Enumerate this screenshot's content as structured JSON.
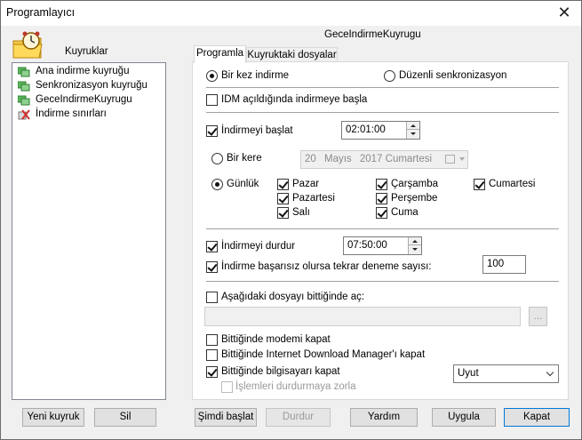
{
  "window": {
    "title": "Programlayıcı",
    "close_glyph": "✕"
  },
  "left": {
    "header": "Kuyruklar",
    "items": [
      {
        "label": "Ana indirme kuyruğu",
        "icon": "queue-icon"
      },
      {
        "label": "Senkronizasyon kuyruğu",
        "icon": "queue-icon"
      },
      {
        "label": "GeceIndirmeKuyrugu",
        "icon": "queue-icon"
      },
      {
        "label": "İndirme sınırları",
        "icon": "limits-icon"
      }
    ],
    "new_queue": "Yeni kuyruk",
    "delete": "Sil"
  },
  "right": {
    "queue_title": "GeceIndirmeKuyrugu",
    "tabs": [
      {
        "label": "Programla"
      },
      {
        "label": "Kuyruktaki dosyalar"
      }
    ]
  },
  "schedule": {
    "once_download": "Bir kez indirme",
    "periodic_sync": "Düzenli senkronizasyon",
    "start_on_idm": "IDM açıldığında indirmeye başla",
    "start_download": "İndirmeyi başlat",
    "start_time": "02:01:00",
    "once": "Bir kere",
    "date": {
      "day": "20",
      "month": "Mayıs",
      "year_weekday": "2017 Cumartesi"
    },
    "daily": "Günlük",
    "days": {
      "sun": "Pazar",
      "mon": "Pazartesi",
      "tue": "Salı",
      "wed": "Çarşamba",
      "thu": "Perşembe",
      "fri": "Cuma",
      "sat": "Cumartesi"
    },
    "stop_download": "İndirmeyi durdur",
    "stop_time": "07:50:00",
    "retry_label": "İndirme başarısız olursa tekrar deneme sayısı:",
    "retry_count": "100",
    "open_file_label": "Aşağıdaki dosyayı bittiğinde aç:",
    "open_file_value": "",
    "browse": "...",
    "hangup_modem": "Bittiğinde modemi kapat",
    "exit_idm": "Bittiğinde Internet Download Manager'ı kapat",
    "turn_off_pc": "Bittiğinde bilgisayarı kapat",
    "force_processes": "İşlemleri durdurmaya zorla",
    "power_action": "Uyut"
  },
  "buttons": {
    "start_now": "Şimdi başlat",
    "stop": "Durdur",
    "help": "Yardım",
    "apply": "Uygula",
    "close": "Kapat"
  },
  "colors": {
    "accent": "#0078d7",
    "tab_border": "#d9d9d9",
    "disabled_text": "#9a9a9a"
  }
}
